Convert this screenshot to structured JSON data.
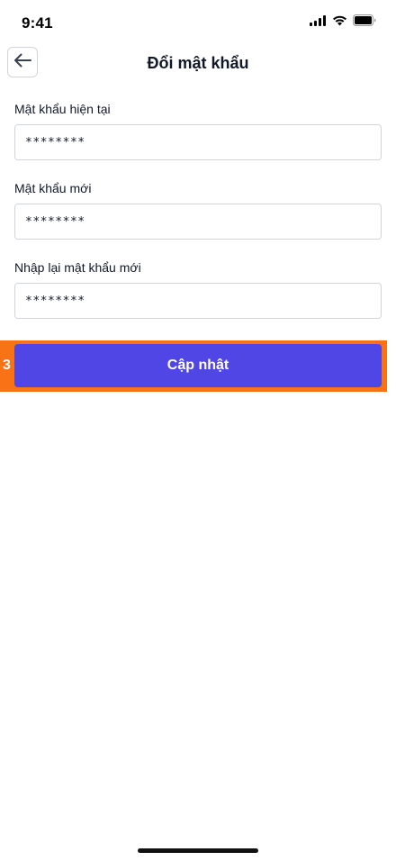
{
  "status_bar": {
    "time": "9:41",
    "icons": [
      "signal-icon",
      "wifi-icon",
      "battery-icon"
    ]
  },
  "header": {
    "back_icon": "arrow-left-icon",
    "title": "Đổi mật khẩu"
  },
  "form": {
    "fields": [
      {
        "label": "Mật khẩu hiện tại",
        "value": "********"
      },
      {
        "label": "Mật khẩu mới",
        "value": "********"
      },
      {
        "label": "Nhập lại mật khẩu mới",
        "value": "********"
      }
    ],
    "submit_label": "Cập nhật"
  },
  "highlight": {
    "number": "3",
    "color": "#f97316"
  },
  "colors": {
    "primary": "#4f46e5",
    "border": "#d1d5db",
    "text": "#111827"
  }
}
